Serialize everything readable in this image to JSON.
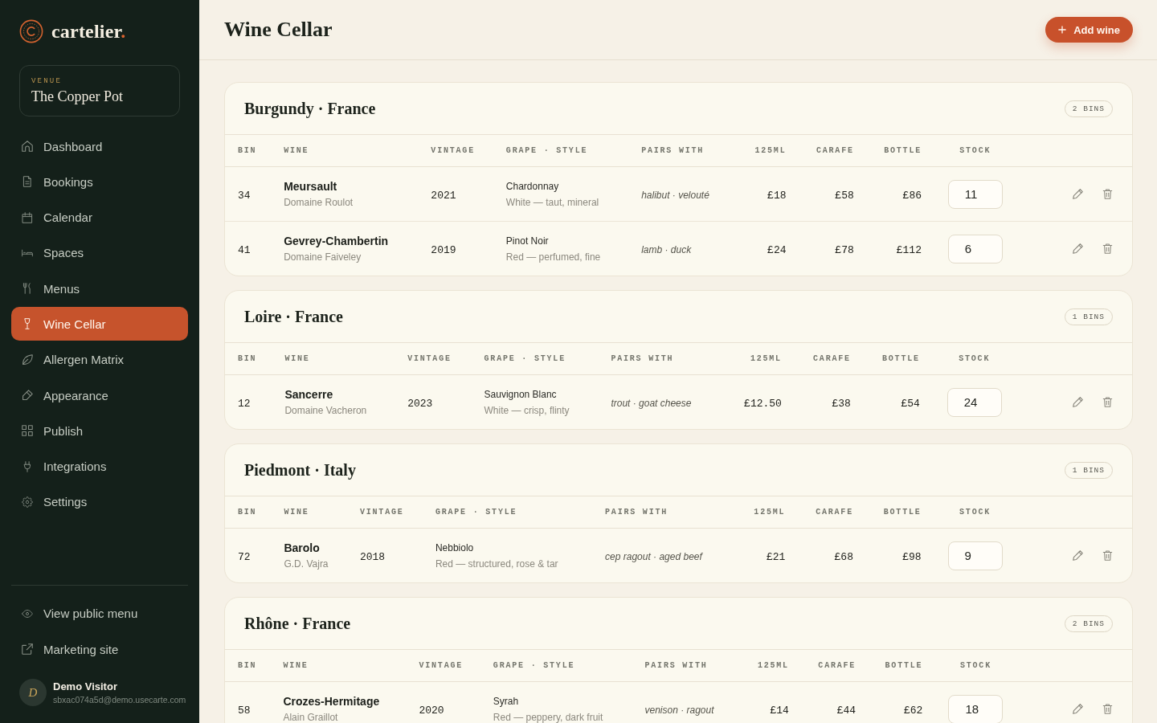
{
  "sidebar": {
    "brand": {
      "name": "cartelier",
      "mark": "."
    },
    "venue": {
      "label": "VENUE",
      "name": "The Copper Pot"
    },
    "nav": [
      {
        "label": "Dashboard",
        "selected": false
      },
      {
        "label": "Bookings",
        "selected": false
      },
      {
        "label": "Calendar",
        "selected": false
      },
      {
        "label": "Spaces",
        "selected": false
      },
      {
        "label": "Menus",
        "selected": false
      },
      {
        "label": "Wine Cellar",
        "selected": true
      },
      {
        "label": "Allergen Matrix",
        "selected": false
      },
      {
        "label": "Appearance",
        "selected": false
      },
      {
        "label": "Publish",
        "selected": false
      },
      {
        "label": "Integrations",
        "selected": false
      },
      {
        "label": "Settings",
        "selected": false
      }
    ],
    "links": [
      {
        "label": "View public menu"
      },
      {
        "label": "Marketing site"
      }
    ],
    "user": {
      "initial": "D",
      "name": "Demo Visitor",
      "email": "sbxac074a5d@demo.usecarte.com"
    }
  },
  "header": {
    "title": "Wine Cellar",
    "add_button": {
      "label": "Add wine"
    }
  },
  "sections": [
    {
      "title": "Burgundy · France",
      "badge": "2 BINS",
      "columns": [
        "BIN",
        "WINE",
        "VINTAGE",
        "GRAPE · STYLE",
        "PAIRS WITH",
        "125ML",
        "CARAFE",
        "BOTTLE",
        "STOCK"
      ],
      "rows": [
        {
          "bin": "34",
          "wine": "Meursault",
          "producer": "Domaine Roulot",
          "vintage": "2021",
          "grape": "Chardonnay",
          "style": "White — taut, mineral",
          "pairs_with": "halibut · velouté",
          "glass": "£18",
          "carafe": "£58",
          "bottle": "£86",
          "stock": "11"
        },
        {
          "bin": "41",
          "wine": "Gevrey-Chambertin",
          "producer": "Domaine Faiveley",
          "vintage": "2019",
          "grape": "Pinot Noir",
          "style": "Red — perfumed, fine",
          "pairs_with": "lamb · duck",
          "glass": "£24",
          "carafe": "£78",
          "bottle": "£112",
          "stock": "6"
        }
      ]
    },
    {
      "title": "Loire · France",
      "badge": "1 BINS",
      "columns": [
        "BIN",
        "WINE",
        "VINTAGE",
        "GRAPE · STYLE",
        "PAIRS WITH",
        "125ML",
        "CARAFE",
        "BOTTLE",
        "STOCK"
      ],
      "rows": [
        {
          "bin": "12",
          "wine": "Sancerre",
          "producer": "Domaine Vacheron",
          "vintage": "2023",
          "grape": "Sauvignon Blanc",
          "style": "White — crisp, flinty",
          "pairs_with": "trout · goat cheese",
          "glass": "£12.50",
          "carafe": "£38",
          "bottle": "£54",
          "stock": "24"
        }
      ]
    },
    {
      "title": "Piedmont · Italy",
      "badge": "1 BINS",
      "columns": [
        "BIN",
        "WINE",
        "VINTAGE",
        "GRAPE · STYLE",
        "PAIRS WITH",
        "125ML",
        "CARAFE",
        "BOTTLE",
        "STOCK"
      ],
      "rows": [
        {
          "bin": "72",
          "wine": "Barolo",
          "producer": "G.D. Vajra",
          "vintage": "2018",
          "grape": "Nebbiolo",
          "style": "Red — structured, rose & tar",
          "pairs_with": "cep ragout · aged beef",
          "glass": "£21",
          "carafe": "£68",
          "bottle": "£98",
          "stock": "9"
        }
      ]
    },
    {
      "title": "Rhône · France",
      "badge": "2 BINS",
      "columns": [
        "BIN",
        "WINE",
        "VINTAGE",
        "GRAPE · STYLE",
        "PAIRS WITH",
        "125ML",
        "CARAFE",
        "BOTTLE",
        "STOCK"
      ],
      "rows": [
        {
          "bin": "58",
          "wine": "Crozes-Hermitage",
          "producer": "Alain Graillot",
          "vintage": "2020",
          "grape": "Syrah",
          "style": "Red — peppery, dark fruit",
          "pairs_with": "venison · ragout",
          "glass": "£14",
          "carafe": "£44",
          "bottle": "£62",
          "stock": "18"
        }
      ]
    }
  ]
}
